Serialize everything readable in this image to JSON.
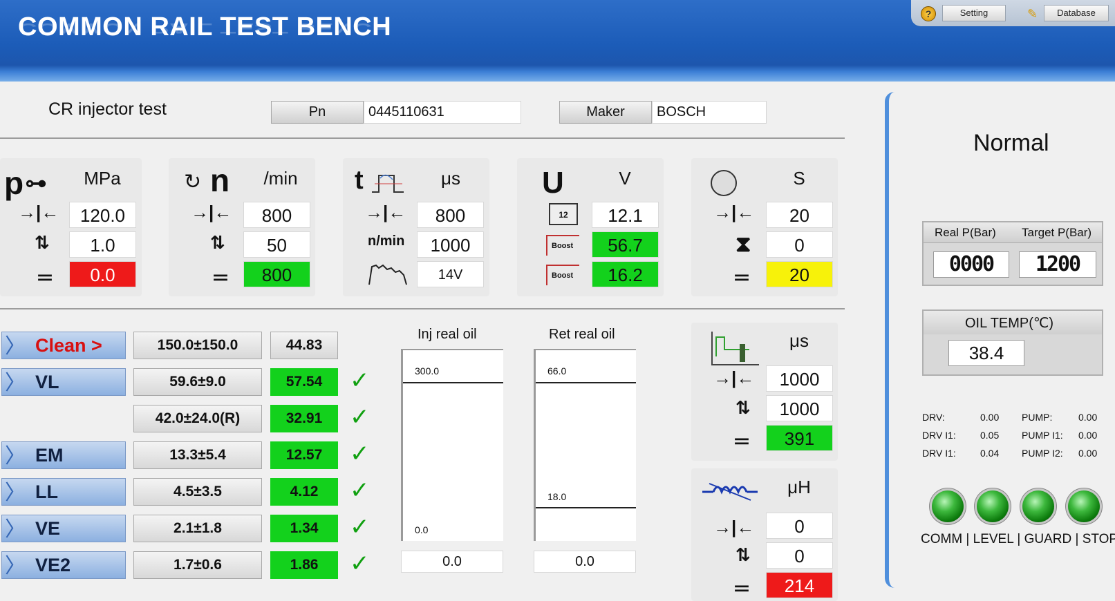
{
  "header": {
    "title": "COMMON RAIL TEST BENCH",
    "setting_label": "Setting",
    "database_label": "Database"
  },
  "info": {
    "test_name": "CR injector test",
    "pn_label": "Pn",
    "pn_value": "0445110631",
    "maker_label": "Maker",
    "maker_value": "BOSCH"
  },
  "panels": {
    "pressure": {
      "symbol": "p",
      "unit": "MPa",
      "set": "120.0",
      "tolerance": "1.0",
      "actual": "0.0"
    },
    "speed": {
      "symbol": "n",
      "unit": "/min",
      "set": "800",
      "tolerance": "50",
      "actual": "800"
    },
    "time": {
      "symbol": "t",
      "unit": "μs",
      "set": "800",
      "freq_label": "n/min",
      "freq": "1000",
      "mode": "14V"
    },
    "voltage": {
      "symbol": "U",
      "unit": "V",
      "battery": "12.1",
      "boost1": "56.7",
      "boost2": "16.2",
      "batt_icon_label": "12",
      "boost_label": "Boost"
    },
    "duration": {
      "unit": "S",
      "set": "20",
      "elapsed": "0",
      "actual": "20"
    },
    "pulse": {
      "unit": "μs",
      "set": "1000",
      "tolerance": "1000",
      "actual": "391"
    },
    "inductance": {
      "unit": "μH",
      "set": "0",
      "tolerance": "0",
      "actual": "214"
    }
  },
  "tests": [
    {
      "label": "Clean >",
      "range": "150.0±150.0",
      "value": "44.83",
      "status": "plain",
      "check": false
    },
    {
      "label": "VL",
      "range": "59.6±9.0",
      "value": "57.54",
      "status": "green",
      "check": true
    },
    {
      "label": "",
      "range": "42.0±24.0(R)",
      "value": "32.91",
      "status": "green",
      "check": true
    },
    {
      "label": "EM",
      "range": "13.3±5.4",
      "value": "12.57",
      "status": "green",
      "check": true
    },
    {
      "label": "LL",
      "range": "4.5±3.5",
      "value": "4.12",
      "status": "green",
      "check": true
    },
    {
      "label": "VE",
      "range": "2.1±1.8",
      "value": "1.34",
      "status": "green",
      "check": true
    },
    {
      "label": "VE2",
      "range": "1.7±0.6",
      "value": "1.86",
      "status": "green",
      "check": true
    }
  ],
  "oil": {
    "inj": {
      "title": "Inj real oil",
      "top": "300.0",
      "bottom": "0.0",
      "value": "0.0"
    },
    "ret": {
      "title": "Ret real oil",
      "top": "66.0",
      "mid": "18.0",
      "value": "0.0"
    }
  },
  "status_panel": {
    "state": "Normal",
    "real_p_label": "Real P(Bar)",
    "target_p_label": "Target P(Bar)",
    "real_p": "0000",
    "target_p": "1200",
    "oil_temp_label": "OIL TEMP(℃)",
    "oil_temp": "38.4",
    "readings": [
      {
        "label": "DRV:",
        "value": "0.00",
        "label2": "PUMP:",
        "value2": "0.00"
      },
      {
        "label": "DRV I1:",
        "value": "0.05",
        "label2": "PUMP I1:",
        "value2": "0.00"
      },
      {
        "label": "DRV I1:",
        "value": "0.04",
        "label2": "PUMP I2:",
        "value2": "0.00"
      }
    ],
    "indicators": "COMM | LEVEL | GUARD | STOP",
    "led_color": "#2fae2f"
  }
}
